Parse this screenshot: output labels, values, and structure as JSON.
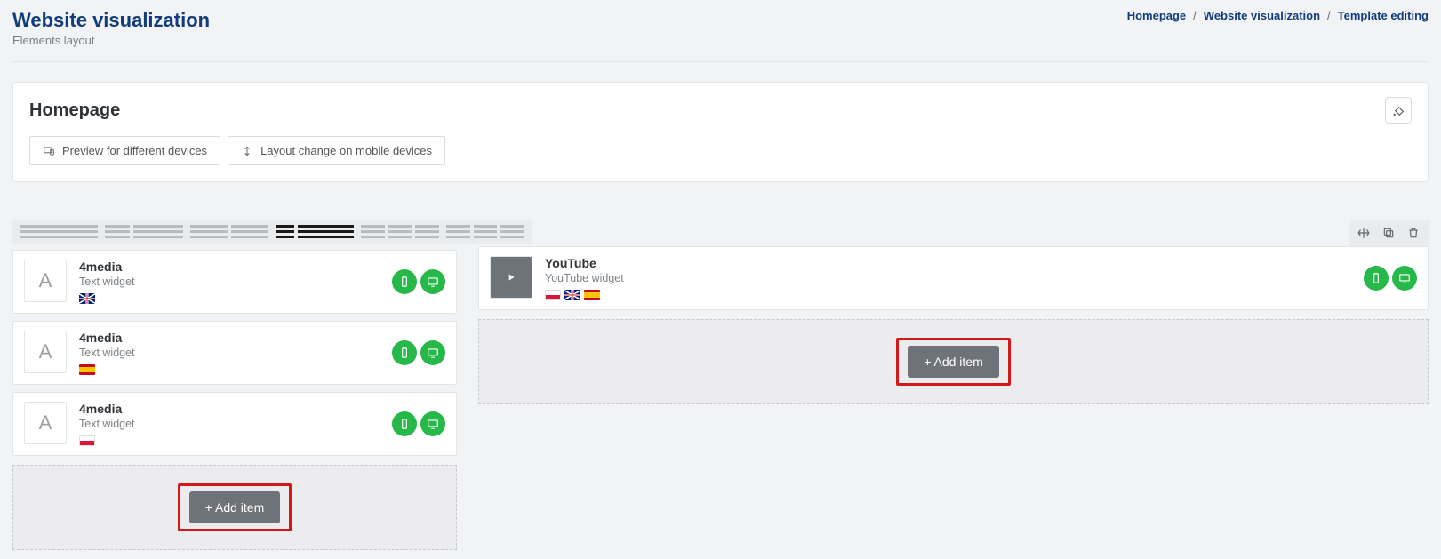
{
  "header": {
    "title": "Website visualization",
    "subtitle": "Elements layout"
  },
  "breadcrumb": {
    "item1": "Homepage",
    "item2": "Website visualization",
    "item3": "Template editing"
  },
  "panel": {
    "title": "Homepage",
    "preview_btn": "Preview for different devices",
    "layout_btn": "Layout change on mobile devices"
  },
  "columns": {
    "left": {
      "widgets": [
        {
          "title": "4media",
          "type": "Text widget",
          "flags": [
            "gb"
          ]
        },
        {
          "title": "4media",
          "type": "Text widget",
          "flags": [
            "es"
          ]
        },
        {
          "title": "4media",
          "type": "Text widget",
          "flags": [
            "pl"
          ]
        }
      ],
      "add_label": "+ Add item"
    },
    "right": {
      "widgets": [
        {
          "title": "YouTube",
          "type": "YouTube widget",
          "flags": [
            "pl",
            "gb",
            "es"
          ]
        }
      ],
      "add_label": "+ Add item"
    }
  }
}
